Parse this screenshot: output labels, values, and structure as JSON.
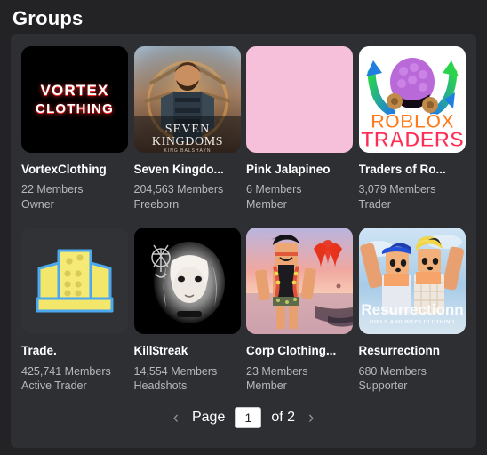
{
  "header": {
    "title": "Groups"
  },
  "groups": [
    {
      "name": "VortexClothing",
      "members": "22 Members",
      "rank": "Owner",
      "thumbnail": "vortex-clothing-logo"
    },
    {
      "name": "Seven Kingdo...",
      "members": "204,563 Members",
      "rank": "Freeborn",
      "thumbnail": "seven-kingdoms-samurai"
    },
    {
      "name": "Pink Jalapineo",
      "members": "6 Members",
      "rank": "Member",
      "thumbnail": "pink-solid-color"
    },
    {
      "name": "Traders of Ro...",
      "members": "3,079 Members",
      "rank": "Trader",
      "thumbnail": "roblox-traders-egg-logo"
    },
    {
      "name": "Trade.",
      "members": "425,741 Members",
      "rank": "Active Trader",
      "thumbnail": "trade-building-icon"
    },
    {
      "name": "Kill$treak",
      "members": "14,554 Members",
      "rank": "Headshots",
      "thumbnail": "killstreak-portrait"
    },
    {
      "name": "Corp Clothing...",
      "members": "23 Members",
      "rank": "Member",
      "thumbnail": "corp-clothing-avatar-beach"
    },
    {
      "name": "Resurrectionn",
      "members": "680 Members",
      "rank": "Supporter",
      "thumbnail": "resurrectionn-avatars"
    }
  ],
  "pagination": {
    "prev_icon": "chevron-left",
    "page_label": "Page",
    "current_page": "1",
    "of_label": "of 2",
    "next_icon": "chevron-right"
  },
  "colors": {
    "page_background": "#232326",
    "container_background": "#2e2f33",
    "title_text": "#ffffff",
    "muted_text": "#b6b8bb",
    "pink_thumbnail": "#f7c0da"
  }
}
